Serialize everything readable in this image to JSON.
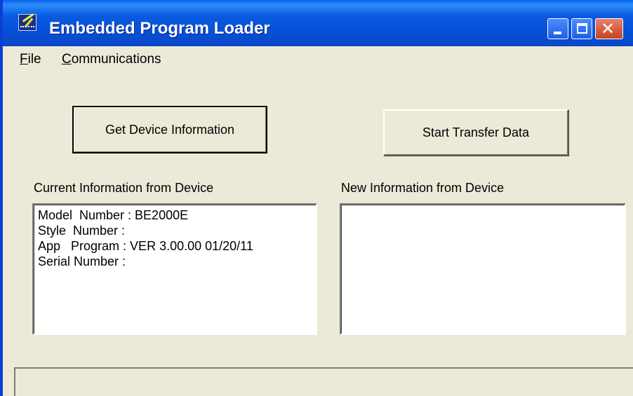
{
  "window": {
    "title": "Embedded Program Loader",
    "icon": "app-icon",
    "controls": [
      "minimize-icon",
      "maximize-icon",
      "close-icon"
    ],
    "colors": {
      "titlebar": "#0a5ae0",
      "face": "#ece9d8",
      "close": "#c8421c"
    }
  },
  "menubar": {
    "items": [
      {
        "label": "File",
        "mnemonic": "F",
        "rest": "ile"
      },
      {
        "label": "Communications",
        "mnemonic": "C",
        "rest": "ommunications"
      }
    ]
  },
  "buttons": {
    "get_info": "Get Device Information",
    "start_transfer": "Start Transfer Data"
  },
  "current_info": {
    "label": "Current Information from Device",
    "lines": [
      "Model  Number : BE2000E",
      "Style  Number :",
      "App   Program : VER 3.00.00 01/20/11",
      "Serial Number :"
    ]
  },
  "new_info": {
    "label": "New Information from Device",
    "lines": []
  },
  "statusbar": {
    "text": ""
  }
}
